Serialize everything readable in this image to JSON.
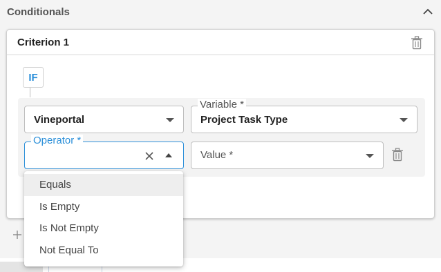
{
  "section": {
    "title": "Conditionals"
  },
  "criterion": {
    "title": "Criterion 1"
  },
  "condition": {
    "badge": "IF"
  },
  "fields": {
    "source": {
      "value": "Vineportal"
    },
    "variable": {
      "label": "Variable *",
      "value": "Project Task Type"
    },
    "operator": {
      "label": "Operator *",
      "value": ""
    },
    "value": {
      "placeholder": "Value *"
    }
  },
  "operator_menu": {
    "options": [
      "Equals",
      "Is Empty",
      "Is Not Empty",
      "Not Equal To"
    ],
    "highlighted": "Equals"
  },
  "colors": {
    "accent": "#2b8fd9",
    "panel_bg": "#f4f4f4",
    "icon_gray": "#8a8a8a"
  },
  "icons": {
    "collapse": "chevron-up-icon",
    "delete": "trash-icon",
    "clear": "close-icon",
    "add": "plus-icon"
  }
}
